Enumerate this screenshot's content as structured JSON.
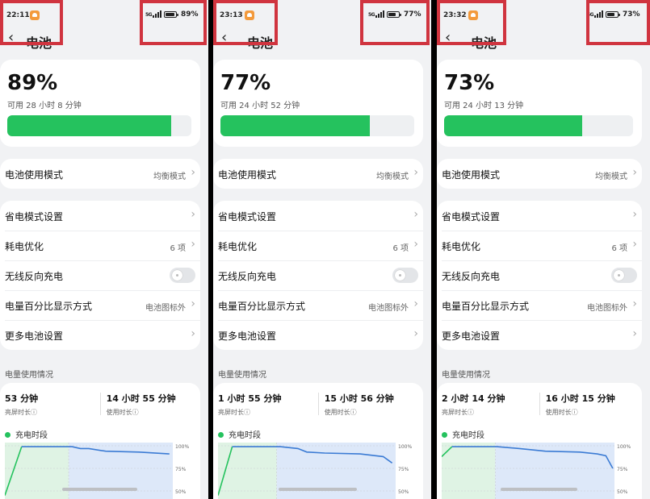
{
  "colors": {
    "accent_green": "#25c25e",
    "highlight_red": "#d0343f",
    "chart_blue": "#3b7bd4"
  },
  "header_title": "电池",
  "section_title": "电量使用情况",
  "legend_label": "充电时段",
  "screens": [
    {
      "time": "22:11",
      "network": "5G",
      "battery_status": "89%",
      "battery_level": 0.89,
      "percent": "89%",
      "available": "可用 28 小时 8 分钟",
      "mode": {
        "label": "电池使用模式",
        "value": "均衡模式"
      },
      "items": [
        {
          "label": "省电模式设置",
          "value": ""
        },
        {
          "label": "耗电优化",
          "value": "6 项"
        },
        {
          "label": "无线反向充电",
          "toggle": false
        },
        {
          "label": "电量百分比显示方式",
          "value": "电池图标外"
        },
        {
          "label": "更多电池设置",
          "value": ""
        }
      ],
      "usage": {
        "screen_on_value": "53 分钟",
        "screen_on_label": "亮屏时长ⓘ",
        "usage_value": "14 小时 55 分钟",
        "usage_label": "使用时长ⓘ"
      },
      "chart_data": {
        "type": "area",
        "y_ticks": [
          "100%",
          "75%",
          "50%"
        ],
        "charging_fraction": 0.38,
        "x": [
          0,
          0.1,
          0.4,
          0.45,
          0.5,
          0.6,
          0.8,
          0.98
        ],
        "values": [
          45,
          99,
          99,
          97,
          97,
          94,
          93,
          91
        ]
      }
    },
    {
      "time": "23:13",
      "network": "5G",
      "battery_status": "77%",
      "battery_level": 0.77,
      "percent": "77%",
      "available": "可用 24 小时 52 分钟",
      "mode": {
        "label": "电池使用模式",
        "value": "均衡模式"
      },
      "items": [
        {
          "label": "省电模式设置",
          "value": ""
        },
        {
          "label": "耗电优化",
          "value": "6 项"
        },
        {
          "label": "无线反向充电",
          "toggle": false
        },
        {
          "label": "电量百分比显示方式",
          "value": "电池图标外"
        },
        {
          "label": "更多电池设置",
          "value": ""
        }
      ],
      "usage": {
        "screen_on_value": "1 小时 55 分钟",
        "screen_on_label": "亮屏时长ⓘ",
        "usage_value": "15 小时 56 分钟",
        "usage_label": "使用时长ⓘ"
      },
      "chart_data": {
        "type": "area",
        "y_ticks": [
          "100%",
          "75%",
          "50%"
        ],
        "charging_fraction": 0.33,
        "x": [
          0,
          0.08,
          0.35,
          0.45,
          0.5,
          0.6,
          0.8,
          0.93,
          0.98
        ],
        "values": [
          45,
          99,
          99,
          97,
          93,
          92,
          91,
          88,
          81
        ]
      }
    },
    {
      "time": "23:32",
      "network": "5G",
      "battery_status": "73%",
      "battery_level": 0.73,
      "percent": "73%",
      "available": "可用 24 小时 13 分钟",
      "mode": {
        "label": "电池使用模式",
        "value": "均衡模式"
      },
      "items": [
        {
          "label": "省电模式设置",
          "value": ""
        },
        {
          "label": "耗电优化",
          "value": "6 项"
        },
        {
          "label": "无线反向充电",
          "toggle": false
        },
        {
          "label": "电量百分比显示方式",
          "value": "电池图标外"
        },
        {
          "label": "更多电池设置",
          "value": ""
        }
      ],
      "usage": {
        "screen_on_value": "2 小时 14 分钟",
        "screen_on_label": "亮屏时长ⓘ",
        "usage_value": "16 小时 15 分钟",
        "usage_label": "使用时长ⓘ"
      },
      "chart_data": {
        "type": "area",
        "y_ticks": [
          "100%",
          "75%",
          "50%"
        ],
        "charging_fraction": 0.31,
        "x": [
          0,
          0.06,
          0.32,
          0.45,
          0.6,
          0.8,
          0.9,
          0.95,
          0.99
        ],
        "values": [
          88,
          99,
          99,
          97,
          94,
          93,
          91,
          89,
          75
        ]
      }
    }
  ]
}
